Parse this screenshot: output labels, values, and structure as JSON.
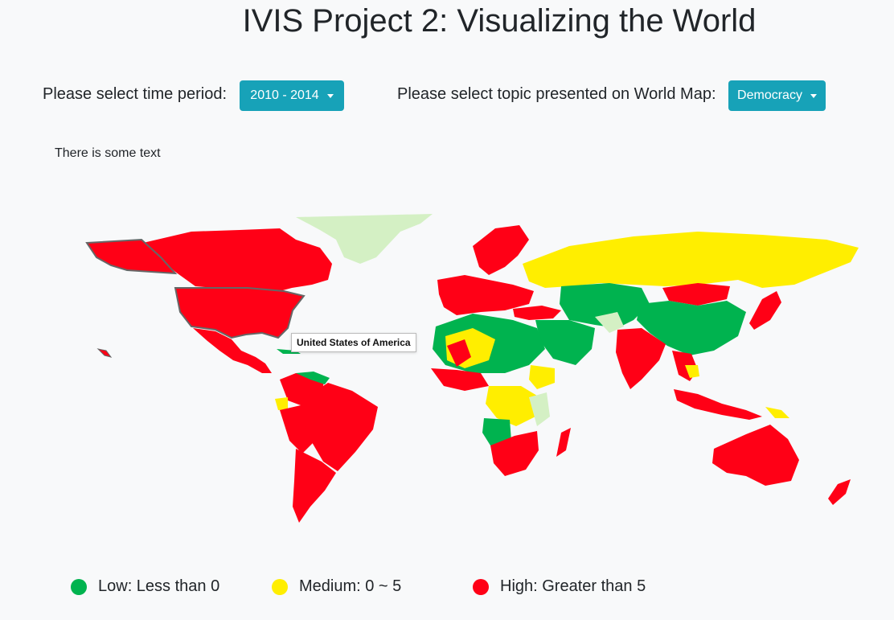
{
  "header": {
    "title": "IVIS Project 2: Visualizing the World"
  },
  "controls": {
    "time_label": "Please select time period:",
    "time_value": "2010 - 2014",
    "topic_label": "Please select topic presented on World Map:",
    "topic_value": "Democracy"
  },
  "note": "There is some text",
  "map": {
    "tooltip": "United States of America",
    "colors": {
      "low": "#00b34f",
      "medium": "#ffee00",
      "high": "#ff0016",
      "nodata": "#d4f0c4",
      "highlight_border": "#666666"
    }
  },
  "legend": [
    {
      "label": "Low: Less than 0",
      "color": "#00b34f"
    },
    {
      "label": "Medium: 0 ~ 5",
      "color": "#ffee00"
    },
    {
      "label": "High: Greater than 5",
      "color": "#ff0016"
    }
  ]
}
